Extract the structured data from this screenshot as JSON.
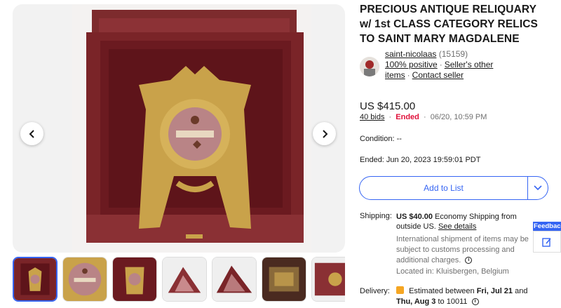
{
  "viewer": {
    "prev_icon": "chevron-left-icon",
    "next_icon": "chevron-right-icon"
  },
  "thumbnails": [
    {
      "name": "thumb-1"
    },
    {
      "name": "thumb-2"
    },
    {
      "name": "thumb-3"
    },
    {
      "name": "thumb-4"
    },
    {
      "name": "thumb-5"
    },
    {
      "name": "thumb-6"
    },
    {
      "name": "thumb-7"
    }
  ],
  "title": "PRECIOUS ANTIQUE RELIQUARY w/ 1st CLASS CATEGORY RELICS TO SAINT MARY MAGDALENE",
  "seller": {
    "name": "saint-nicolaas",
    "count": "(15159)",
    "positive": "100% positive",
    "other_items": "Seller's other items",
    "contact": "Contact seller"
  },
  "price": "US $415.00",
  "bids": "40 bids",
  "ended_badge": "Ended",
  "ended_date": "06/20, 10:59 PM",
  "condition": "Condition:  --",
  "ended_full": "Ended:  Jun 20, 2023 19:59:01 PDT",
  "add_to_list": "Add to List",
  "shipping": {
    "label": "Shipping:",
    "cost": "US $40.00",
    "desc": "Economy Shipping from outside US.",
    "see_details": "See details",
    "intl": "International shipment of items may be subject to customs processing and additional charges.",
    "located": "Located in: Kluisbergen, Belgium"
  },
  "delivery": {
    "label": "Delivery:",
    "prefix": "Estimated between",
    "start": "Fri, Jul 21",
    "and": "and",
    "end": "Thu, Aug 3",
    "to": "to 10011"
  },
  "feedback": "Feedback",
  "colors": {
    "accent": "#3665f3",
    "ended": "#e0103a",
    "muted": "#707070"
  }
}
